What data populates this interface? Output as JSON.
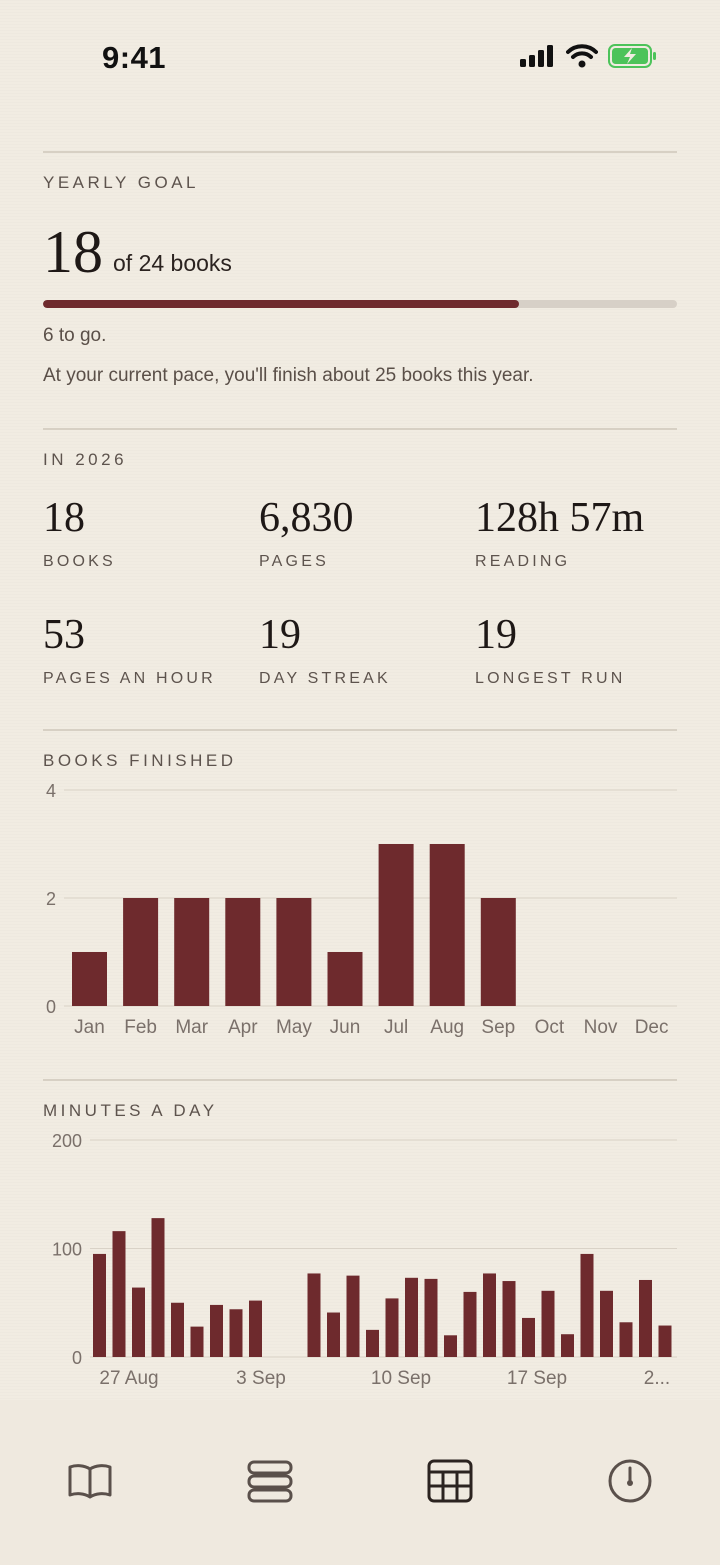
{
  "status_bar": {
    "time": "9:41"
  },
  "yearly_goal": {
    "label": "YEARLY GOAL",
    "count": "18",
    "of_text": "of 24 books",
    "progress": 0.75,
    "remaining": "6 to go.",
    "pace": "At your current pace, you'll finish about 25 books this year."
  },
  "stats": {
    "label": "IN 2026",
    "items": [
      {
        "value": "18",
        "label": "BOOKS"
      },
      {
        "value": "6,830",
        "label": "PAGES"
      },
      {
        "value": "128h 57m",
        "label": "READING"
      },
      {
        "value": "53",
        "label": "PAGES AN HOUR"
      },
      {
        "value": "19",
        "label": "DAY STREAK"
      },
      {
        "value": "19",
        "label": "LONGEST RUN"
      }
    ]
  },
  "books_chart_label": "BOOKS FINISHED",
  "minutes_chart_label": "MINUTES A DAY",
  "chart_data": [
    {
      "type": "bar",
      "categories": [
        "Jan",
        "Feb",
        "Mar",
        "Apr",
        "May",
        "Jun",
        "Jul",
        "Aug",
        "Sep",
        "Oct",
        "Nov",
        "Dec"
      ],
      "values": [
        1,
        2,
        2,
        2,
        2,
        1,
        3,
        3,
        2,
        0,
        0,
        0
      ],
      "ylim": [
        0,
        4
      ],
      "yticks": [
        "0",
        "2",
        "4"
      ],
      "color": "#6e2a2d"
    },
    {
      "type": "bar",
      "x_tick_labels": [
        "27 Aug",
        "3 Sep",
        "10 Sep",
        "17 Sep",
        "2..."
      ],
      "values": [
        95,
        116,
        64,
        128,
        50,
        28,
        48,
        44,
        52,
        0,
        0,
        77,
        41,
        75,
        25,
        54,
        73,
        72,
        20,
        60,
        77,
        70,
        36,
        61,
        21,
        95,
        61,
        32,
        71,
        29
      ],
      "ylim": [
        0,
        200
      ],
      "yticks": [
        "0",
        "100",
        "200"
      ],
      "color": "#6e2a2d"
    }
  ],
  "tabbar": {
    "tabs": [
      {
        "icon": "book-icon"
      },
      {
        "icon": "stack-icon"
      },
      {
        "icon": "grid-icon",
        "active": true
      },
      {
        "icon": "timer-icon"
      }
    ]
  }
}
